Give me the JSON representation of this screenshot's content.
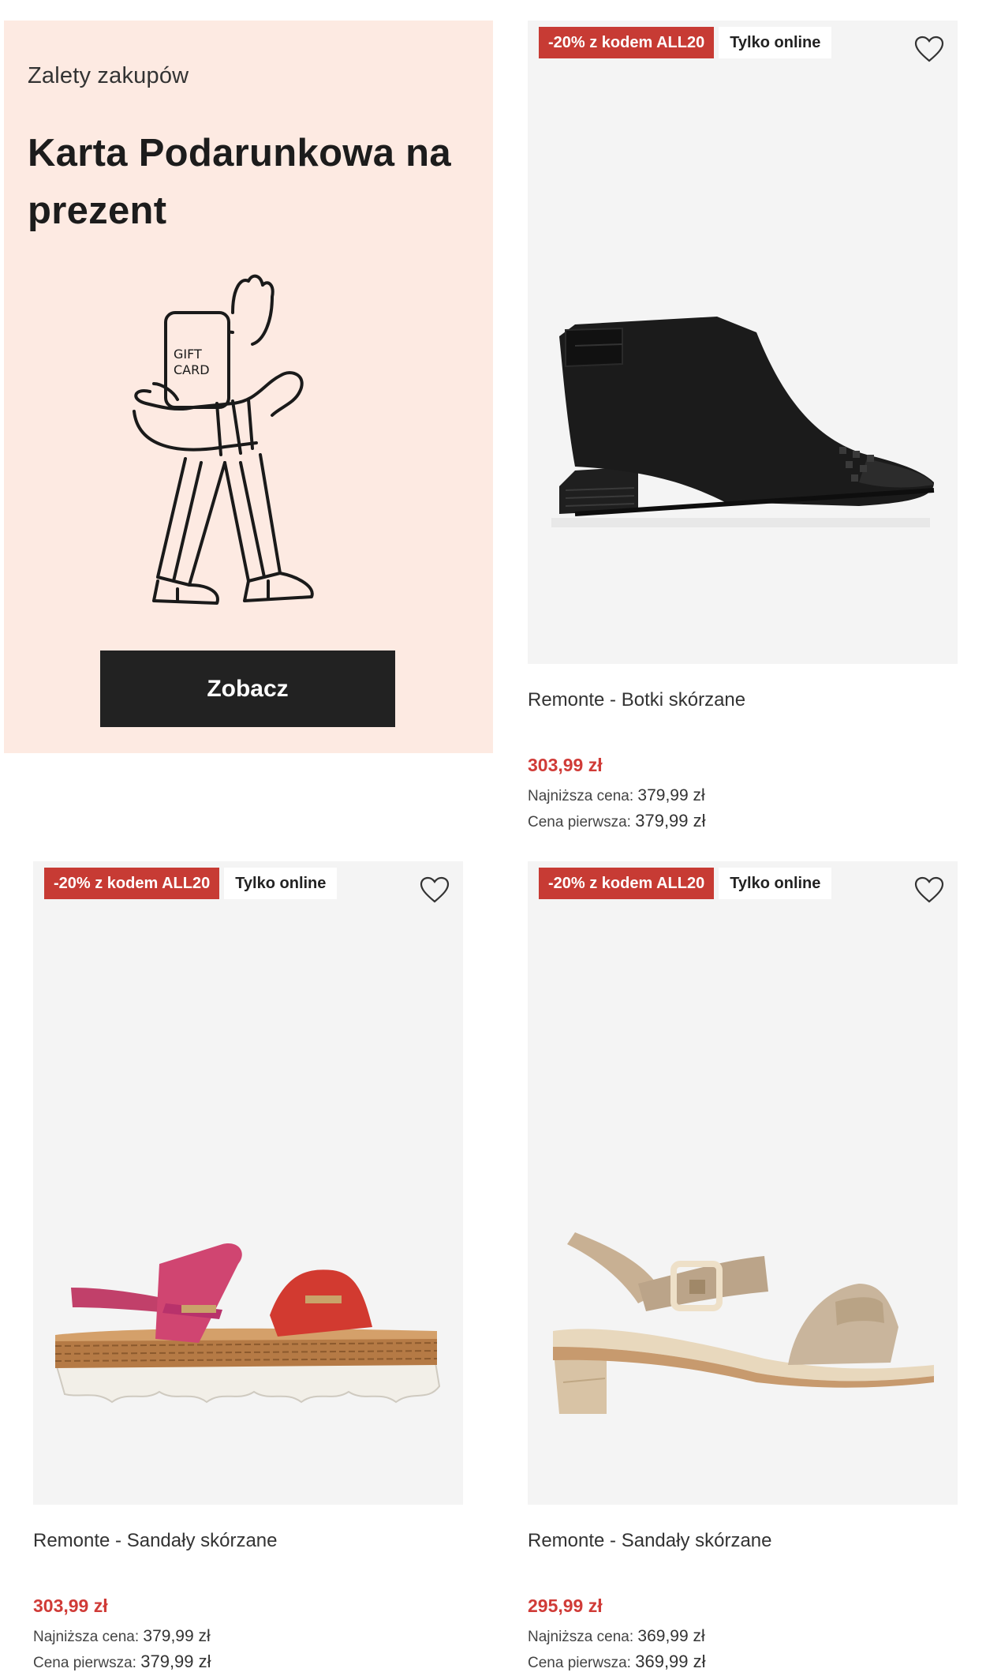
{
  "promo": {
    "eyebrow": "Zalety zakupów",
    "title": "Karta Podarunkowa na prezent",
    "card_text_line1": "GIFT",
    "card_text_line2": "CARD",
    "button_label": "Zobacz",
    "background": "#fdeae2"
  },
  "badges": {
    "discount": "-20% z kodem ALL20",
    "online": "Tylko online",
    "discount_color": "#c73b34"
  },
  "price_color": "#d03b37",
  "labels": {
    "lowest": "Najniższa cena:",
    "first": "Cena pierwsza:"
  },
  "products": [
    {
      "name": "Remonte - Botki skórzane",
      "price": "303,99 zł",
      "lowest_price": "379,99 zł",
      "first_price": "379,99 zł",
      "image": "black-leather-open-toe-bootie"
    },
    {
      "name": "Remonte - Sandały skórzane",
      "price": "303,99 zł",
      "lowest_price": "379,99 zł",
      "first_price": "379,99 zł",
      "image": "pink-red-platform-sandal"
    },
    {
      "name": "Remonte - Sandały skórzane",
      "price": "295,99 zł",
      "lowest_price": "369,99 zł",
      "first_price": "369,99 zł",
      "image": "gold-block-heel-sandal"
    }
  ]
}
